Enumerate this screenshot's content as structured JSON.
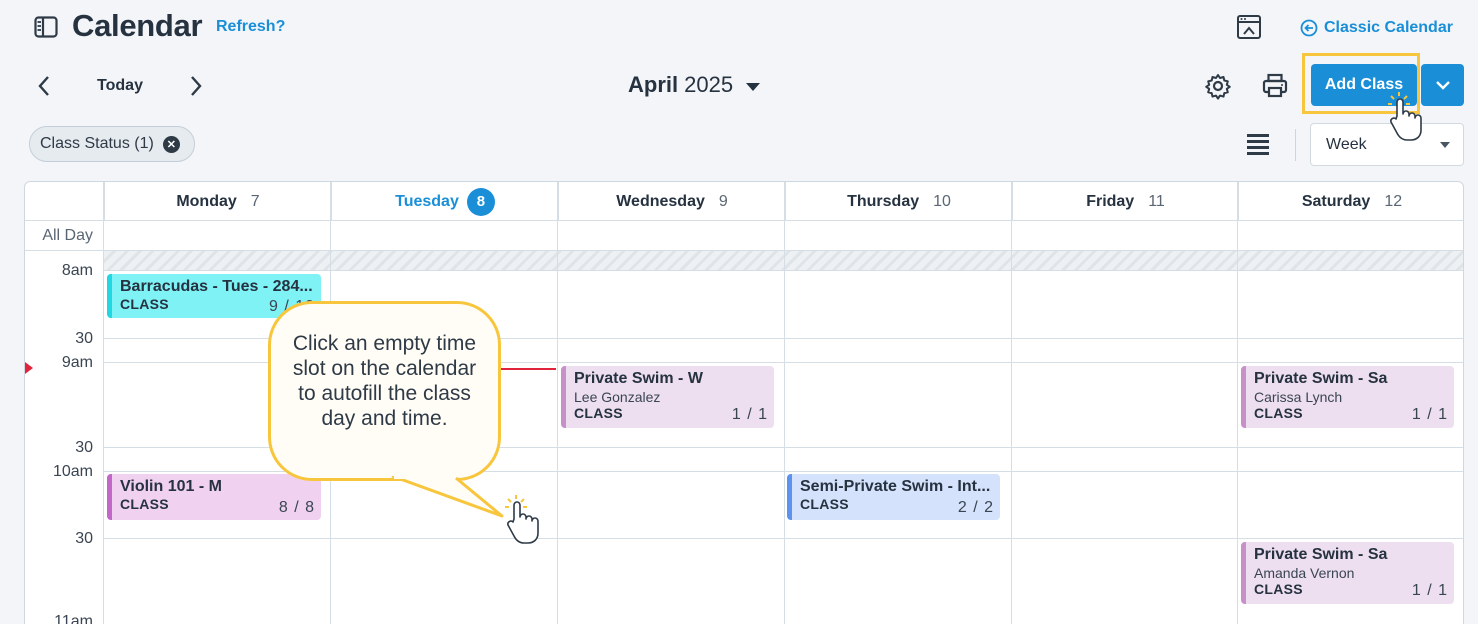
{
  "header": {
    "title": "Calendar",
    "refresh_label": "Refresh?",
    "classic_label": "Classic Calendar"
  },
  "toolbar": {
    "today_label": "Today",
    "month": "April",
    "year": "2025",
    "add_class_label": "Add Class"
  },
  "filters": {
    "chip_label": "Class Status (1)",
    "view_selected": "Week"
  },
  "calendar": {
    "days": [
      {
        "name": "Monday",
        "num": "7"
      },
      {
        "name": "Tuesday",
        "num": "8",
        "today": true
      },
      {
        "name": "Wednesday",
        "num": "9"
      },
      {
        "name": "Thursday",
        "num": "10"
      },
      {
        "name": "Friday",
        "num": "11"
      },
      {
        "name": "Saturday",
        "num": "12"
      }
    ],
    "all_day_label": "All Day",
    "time_labels": [
      "8am",
      "30",
      "9am",
      "30",
      "10am",
      "30",
      "11am"
    ],
    "events": [
      {
        "title": "Barracudas - Tues - 284...",
        "sub": "",
        "type": "CLASS",
        "count": "9 / 10"
      },
      {
        "title": "Violin 101 - M",
        "sub": "",
        "type": "CLASS",
        "count": "8 / 8"
      },
      {
        "title": "Private Swim - W",
        "sub": "Lee Gonzalez",
        "type": "CLASS",
        "count": "1 / 1"
      },
      {
        "title": "Semi-Private Swim - Int...",
        "sub": "",
        "type": "CLASS",
        "count": "2 / 2"
      },
      {
        "title": "Private Swim - Sa",
        "sub": "Carissa Lynch",
        "type": "CLASS",
        "count": "1 / 1"
      },
      {
        "title": "Private Swim - Sa",
        "sub": "Amanda Vernon",
        "type": "CLASS",
        "count": "1 / 1"
      }
    ]
  },
  "tooltip": {
    "text": "Click an empty time slot on the calendar to autofill the class day and time."
  },
  "colors": {
    "accent": "#1a8fd8",
    "highlight": "#f7c63c",
    "now_line": "#e0243b"
  },
  "icons": {
    "sidebar": "sidebar-toggle-icon",
    "embed": "embed-icon",
    "classic": "arrow-left-circle-icon",
    "settings": "gear-icon",
    "print": "printer-icon",
    "list": "list-view-icon",
    "cursor": "hand-pointer-icon"
  }
}
